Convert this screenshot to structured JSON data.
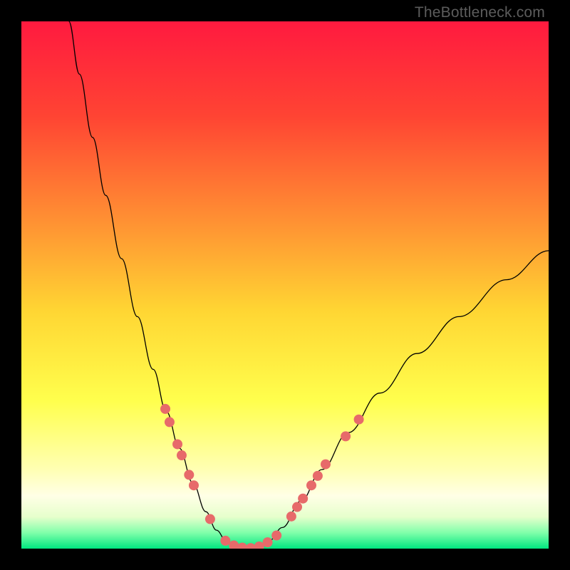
{
  "watermark": "TheBottleneck.com",
  "chart_data": {
    "type": "line",
    "title": "",
    "xlabel": "",
    "ylabel": "",
    "xlim": [
      0,
      100
    ],
    "ylim": [
      0,
      100
    ],
    "grid": false,
    "legend": false,
    "background_gradient": {
      "stops": [
        {
          "offset": 0.0,
          "color": "#ff1a3f"
        },
        {
          "offset": 0.18,
          "color": "#ff4433"
        },
        {
          "offset": 0.4,
          "color": "#ff9933"
        },
        {
          "offset": 0.55,
          "color": "#ffd633"
        },
        {
          "offset": 0.72,
          "color": "#ffff4d"
        },
        {
          "offset": 0.85,
          "color": "#ffffb3"
        },
        {
          "offset": 0.9,
          "color": "#ffffe6"
        },
        {
          "offset": 0.94,
          "color": "#e6ffcc"
        },
        {
          "offset": 0.97,
          "color": "#80ffaa"
        },
        {
          "offset": 1.0,
          "color": "#00e680"
        }
      ]
    },
    "series": [
      {
        "name": "curve",
        "type": "line",
        "color": "#000000",
        "width": 1.3,
        "points": [
          {
            "x": 9.0,
            "y": 100.0
          },
          {
            "x": 11.0,
            "y": 90.0
          },
          {
            "x": 13.5,
            "y": 78.0
          },
          {
            "x": 16.0,
            "y": 67.0
          },
          {
            "x": 19.0,
            "y": 55.0
          },
          {
            "x": 22.0,
            "y": 44.0
          },
          {
            "x": 25.0,
            "y": 34.0
          },
          {
            "x": 27.5,
            "y": 26.0
          },
          {
            "x": 30.0,
            "y": 19.0
          },
          {
            "x": 32.5,
            "y": 12.5
          },
          {
            "x": 35.0,
            "y": 7.0
          },
          {
            "x": 37.0,
            "y": 3.5
          },
          {
            "x": 39.0,
            "y": 1.2
          },
          {
            "x": 41.0,
            "y": 0.3
          },
          {
            "x": 43.0,
            "y": 0.0
          },
          {
            "x": 45.0,
            "y": 0.3
          },
          {
            "x": 47.0,
            "y": 1.5
          },
          {
            "x": 49.5,
            "y": 4.0
          },
          {
            "x": 53.0,
            "y": 9.0
          },
          {
            "x": 57.0,
            "y": 15.0
          },
          {
            "x": 62.0,
            "y": 22.0
          },
          {
            "x": 68.0,
            "y": 29.5
          },
          {
            "x": 75.0,
            "y": 37.0
          },
          {
            "x": 83.0,
            "y": 44.0
          },
          {
            "x": 92.0,
            "y": 51.0
          },
          {
            "x": 100.0,
            "y": 56.5
          }
        ]
      },
      {
        "name": "markers",
        "type": "scatter",
        "color": "#e76a6a",
        "radius": 7,
        "points": [
          {
            "x": 27.3,
            "y": 26.5
          },
          {
            "x": 28.1,
            "y": 24.0
          },
          {
            "x": 29.6,
            "y": 19.8
          },
          {
            "x": 30.4,
            "y": 17.7
          },
          {
            "x": 31.8,
            "y": 14.0
          },
          {
            "x": 32.7,
            "y": 12.0
          },
          {
            "x": 35.8,
            "y": 5.6
          },
          {
            "x": 38.7,
            "y": 1.5
          },
          {
            "x": 40.3,
            "y": 0.6
          },
          {
            "x": 41.9,
            "y": 0.2
          },
          {
            "x": 43.5,
            "y": 0.1
          },
          {
            "x": 45.1,
            "y": 0.4
          },
          {
            "x": 46.7,
            "y": 1.2
          },
          {
            "x": 48.4,
            "y": 2.5
          },
          {
            "x": 51.2,
            "y": 6.1
          },
          {
            "x": 52.3,
            "y": 7.9
          },
          {
            "x": 53.4,
            "y": 9.5
          },
          {
            "x": 55.0,
            "y": 12.0
          },
          {
            "x": 56.2,
            "y": 13.8
          },
          {
            "x": 57.7,
            "y": 16.0
          },
          {
            "x": 61.5,
            "y": 21.3
          },
          {
            "x": 64.0,
            "y": 24.5
          }
        ]
      }
    ]
  }
}
